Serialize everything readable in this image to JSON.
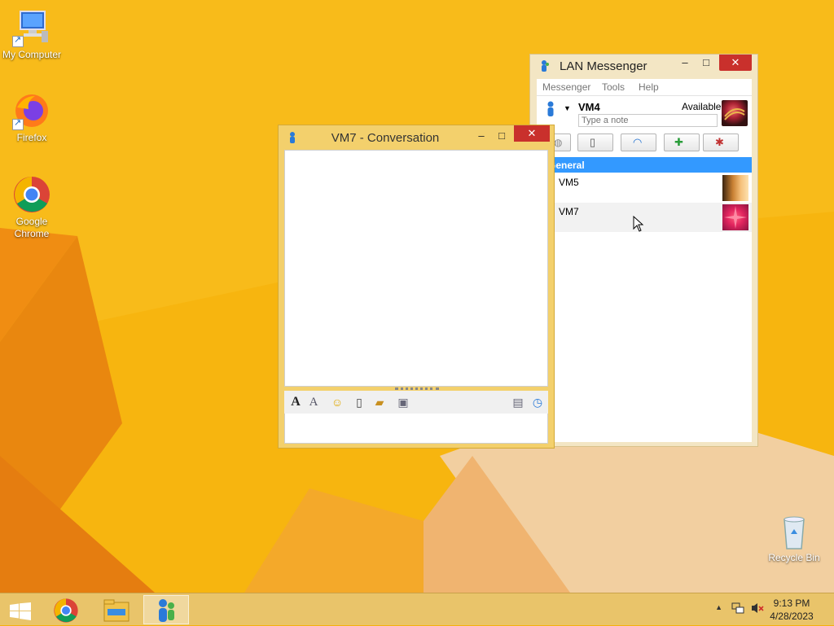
{
  "desktop": {
    "icons": [
      {
        "label": "My Computer",
        "icon": "computer-icon"
      },
      {
        "label": "Firefox",
        "icon": "firefox-icon"
      },
      {
        "label": "Google\nChrome",
        "icon": "chrome-icon"
      },
      {
        "label": "Recycle Bin",
        "icon": "recycle-bin-icon"
      }
    ]
  },
  "lan_messenger": {
    "title": "LAN Messenger",
    "menu": [
      "Messenger",
      "Tools",
      "Help"
    ],
    "user": {
      "name": "VM4",
      "status": "Available",
      "note_placeholder": "Type a note"
    },
    "group": {
      "name": "General"
    },
    "contacts": [
      {
        "name": "VM5"
      },
      {
        "name": "VM7"
      }
    ],
    "toolbar_icons": [
      "chat-icon",
      "file-transfer-icon",
      "broadcast-icon",
      "add-contact-icon",
      "contacts-settings-icon"
    ]
  },
  "conversation": {
    "title": "VM7 - Conversation",
    "toolbar_icons": [
      "font-icon",
      "font-color-icon",
      "emoticon-icon",
      "send-file-icon",
      "send-folder-icon",
      "save-icon",
      "history-icon",
      "clock-icon"
    ]
  },
  "taskbar": {
    "apps": [
      "start-icon",
      "chrome-icon",
      "file-explorer-icon",
      "lan-messenger-icon"
    ],
    "clock": {
      "time": "9:13 PM",
      "date": "4/28/2023"
    }
  },
  "colors": {
    "accent": "#3399ff",
    "close_red": "#c9302c",
    "desktop": "#f6b10d"
  }
}
